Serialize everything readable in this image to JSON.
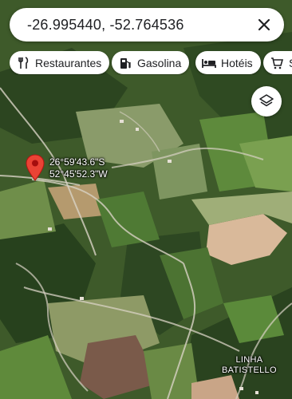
{
  "search": {
    "query": "-26.995440, -52.764536"
  },
  "chips": [
    {
      "label": "Restaurantes",
      "icon": "restaurant-icon"
    },
    {
      "label": "Gasolina",
      "icon": "gas-station-icon"
    },
    {
      "label": "Hotéis",
      "icon": "hotel-icon"
    },
    {
      "label": "S",
      "icon": "shopping-cart-icon"
    }
  ],
  "marker": {
    "lat_label": "26°59'43.6\"S",
    "lng_label": "52°45'52.3\"W",
    "color": "#ea4335"
  },
  "place_label": {
    "line1": "LINHA",
    "line2": "BATISTELLO"
  },
  "map_type": "satellite"
}
